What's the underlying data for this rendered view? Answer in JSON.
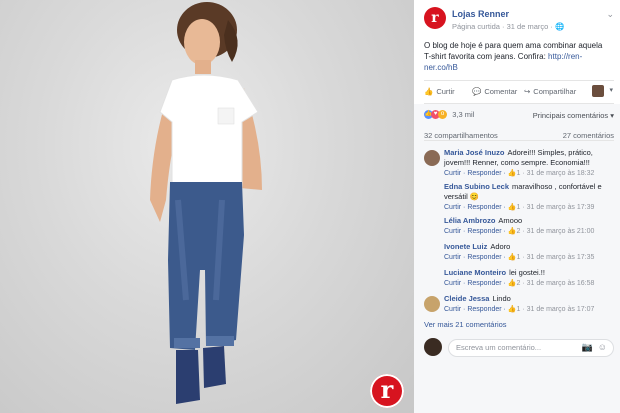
{
  "post": {
    "page_name": "Lojas Renner",
    "meta": "Página curtida · 31 de março · 🌐",
    "text": "O blog de hoje é para quem ama combinar aquela T-shirt favorita com jeans. Confira: ",
    "link": "http://ren-ner.co/hB",
    "logo_letter": "r"
  },
  "actions": {
    "like": "Curtir",
    "comment": "Comentar",
    "share": "Compartilhar"
  },
  "reactions": {
    "count": "3,3 mil",
    "sort": "Principais comentários ▾"
  },
  "counts": {
    "shares": "32 compartilhamentos",
    "comments": "27 comentários"
  },
  "comments": [
    {
      "author": "Maria José Inuzo",
      "text": "Adorei!!! Simples, prático, jovem!!! Renner, como sempre. Economia!!!",
      "reply": "Curtir · Responder · ",
      "likes": "1",
      "date": " · 31 de março às 18:32",
      "avatar": "#8a6a55"
    },
    {
      "author": "Edna Subino Leck",
      "text": "maravilhoso , confortável e versátil 😊",
      "reply": "Curtir · Responder · ",
      "likes": "1",
      "date": " · 31 de março às 17:39",
      "avatar": ""
    },
    {
      "author": "Lélia Ambrozo",
      "text": "Amooo",
      "reply": "Curtir · Responder · ",
      "likes": "2",
      "date": " · 31 de março às 21:00",
      "avatar": ""
    },
    {
      "author": "Ivonete Luiz",
      "text": "Adoro",
      "reply": "Curtir · Responder · ",
      "likes": "1",
      "date": " · 31 de março às 17:35",
      "avatar": ""
    },
    {
      "author": "Luciane Monteiro",
      "text": "lei gostei.!!",
      "reply": "Curtir · Responder · ",
      "likes": "2",
      "date": " · 31 de março às 16:58",
      "avatar": ""
    },
    {
      "author": "Cleide Jessa",
      "text": "Lindo",
      "reply": "Curtir · Responder · ",
      "likes": "1",
      "date": " · 31 de março às 17:07",
      "avatar": "#c7a36b"
    }
  ],
  "more_comments": "Ver mais 21 comentários",
  "write": {
    "placeholder": "Escreva um comentário..."
  },
  "icons": {
    "like": "thumbs-up-icon",
    "comment": "speech-bubble-icon",
    "share": "share-arrow-icon",
    "camera": "camera-icon",
    "emoji": "emoji-icon",
    "globe": "globe-icon"
  },
  "colors": {
    "brand": "#d7131f",
    "link": "#365899",
    "like": "#5890ff"
  }
}
